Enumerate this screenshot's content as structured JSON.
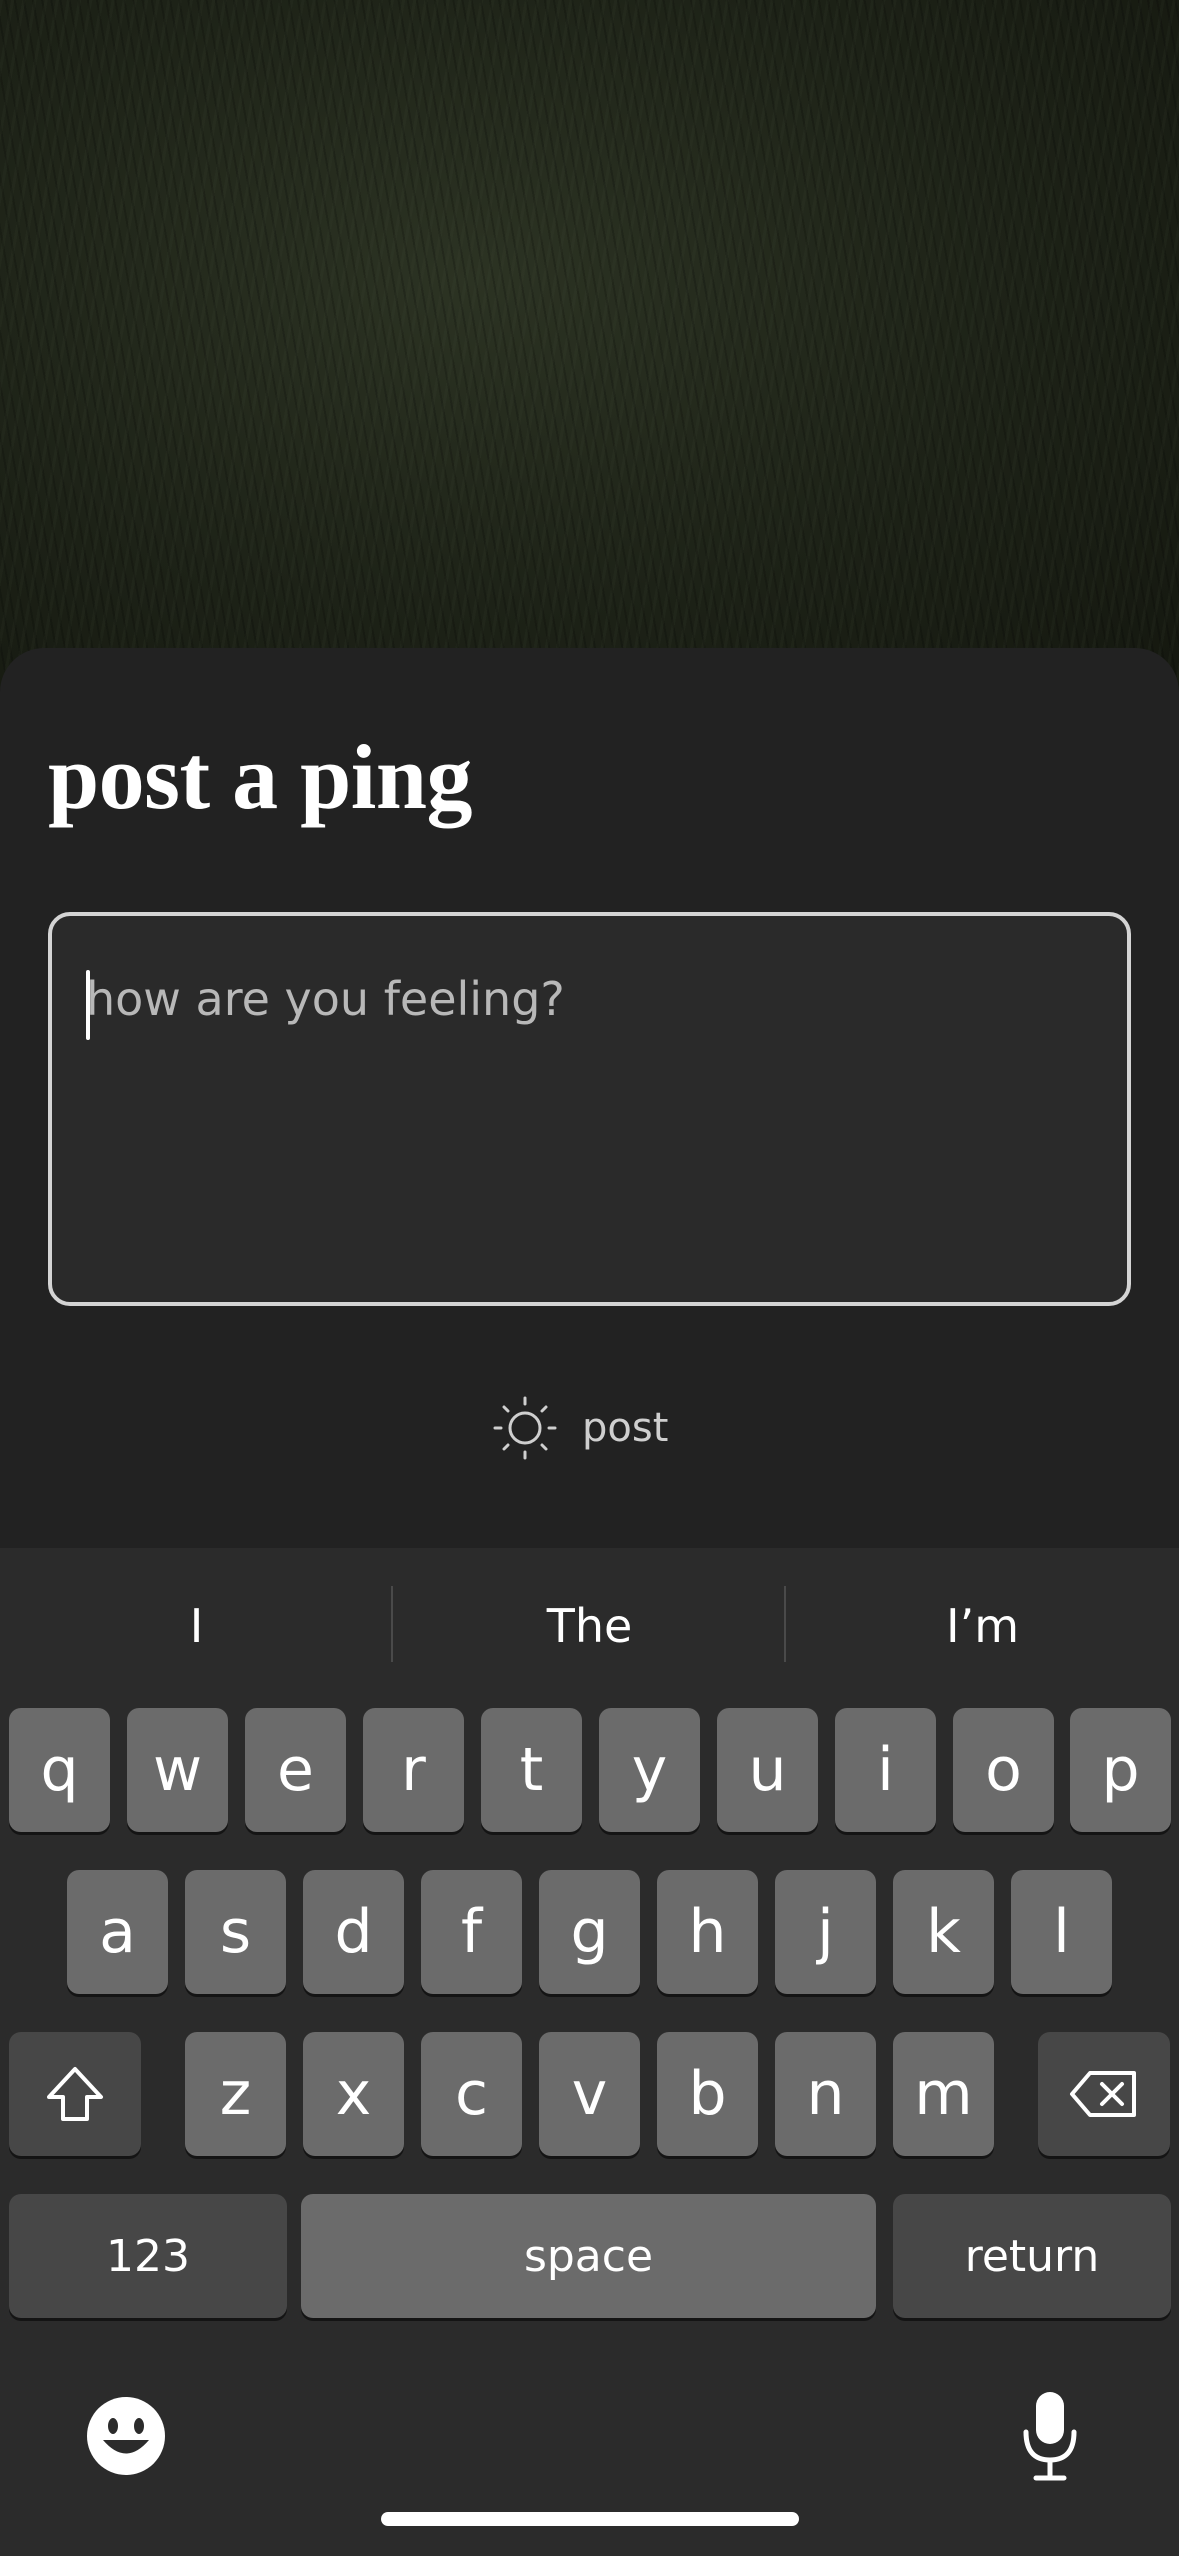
{
  "sheet": {
    "title": "post a ping",
    "input": {
      "placeholder": "how are you feeling?",
      "value": ""
    },
    "post_button": {
      "label": "post",
      "icon": "sun-icon"
    }
  },
  "keyboard": {
    "suggestions": [
      "I",
      "The",
      "I’m"
    ],
    "row1": [
      "q",
      "w",
      "e",
      "r",
      "t",
      "y",
      "u",
      "i",
      "o",
      "p"
    ],
    "row2": [
      "a",
      "s",
      "d",
      "f",
      "g",
      "h",
      "j",
      "k",
      "l"
    ],
    "row3": [
      "z",
      "x",
      "c",
      "v",
      "b",
      "n",
      "m"
    ],
    "numbers_label": "123",
    "space_label": "space",
    "return_label": "return",
    "icons": {
      "shift": "shift-icon",
      "delete": "delete-icon",
      "emoji": "emoji-icon",
      "mic": "microphone-icon"
    }
  }
}
